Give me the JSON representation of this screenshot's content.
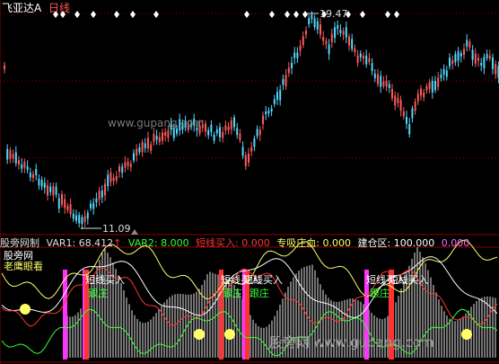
{
  "header": {
    "stock_name": "飞亚达A",
    "period": "日线"
  },
  "price_panel": {
    "high_marker": "19.47",
    "low_marker": "11.09",
    "watermark": "www.gupang.com"
  },
  "indicator_bar": {
    "name": "股旁网制",
    "var1": "VAR1: 68.412",
    "var1_arrow": "↑",
    "var2": "VAR2: 8.000",
    "buy_short": "短线买入: 0.000",
    "absorb": "专吸庄血: 0.000",
    "build": "建仓区: 100.000",
    "last": "0.000"
  },
  "indicator_panel": {
    "name_left": "股旁网",
    "name_left2": "老鹰眼看",
    "signal_buy": "短线买入",
    "signal_follow": "跟庄",
    "watermark": "股旁网  www.gupang.com"
  },
  "colors": {
    "up": "#ff5a5a",
    "down": "#54d8ff",
    "white_line": "#ffffff",
    "yellow_line": "#ffff66",
    "red_line": "#ff3333",
    "green_line": "#33ff33",
    "magenta": "#ff33ff"
  }
}
